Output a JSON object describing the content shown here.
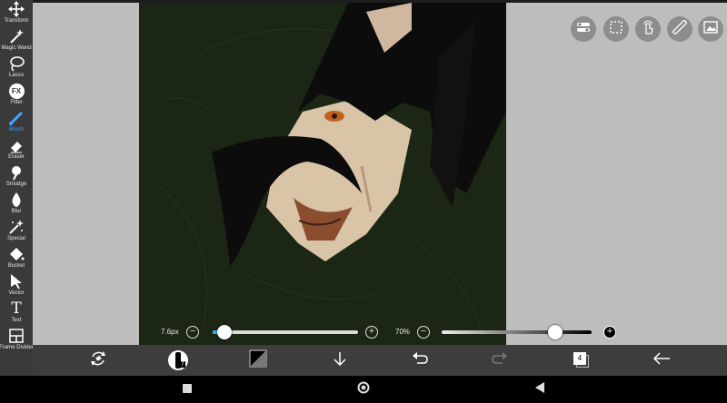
{
  "toolbar": {
    "tools": [
      {
        "label": "Transform",
        "icon": "move-arrows-icon"
      },
      {
        "label": "Magic Wand",
        "icon": "magic-wand-icon"
      },
      {
        "label": "Lasso",
        "icon": "lasso-icon"
      },
      {
        "label": "Filter",
        "icon": "fx-icon"
      },
      {
        "label": "Brush",
        "icon": "brush-icon"
      },
      {
        "label": "Eraser",
        "icon": "eraser-icon"
      },
      {
        "label": "Smudge",
        "icon": "smudge-icon"
      },
      {
        "label": "Blur",
        "icon": "droplet-icon"
      },
      {
        "label": "Special",
        "icon": "sparkle-wand-icon"
      },
      {
        "label": "Bucket",
        "icon": "bucket-icon"
      },
      {
        "label": "Vector",
        "icon": "cursor-arrow-icon"
      },
      {
        "label": "Text",
        "icon": "text-t-icon"
      },
      {
        "label": "Frame Divider",
        "icon": "frame-divider-icon"
      }
    ],
    "fx_text": "FX",
    "text_glyph": "T",
    "active_tool": "Brush"
  },
  "sliders": {
    "size_label": "7.6px",
    "size_minus": "−",
    "size_plus": "+",
    "opacity_label": "70%",
    "opacity_minus": "−",
    "opacity_plus": "+"
  },
  "size_slider": {
    "value_fraction": 0.08
  },
  "opacity_slider": {
    "value_fraction": 0.76
  },
  "bottombar": {
    "layer_count": "4",
    "brush_size_badge": "7"
  },
  "quick_icons": [
    "toggle-icon",
    "selection-icon",
    "touch-icon",
    "ruler-icon",
    "image-icon"
  ],
  "colors": {
    "toolbar_bg": "#3a3a3a",
    "workspace_bg": "#bdbdbd",
    "canvas_bg": "#1b2615",
    "accent": "#3ea6ff",
    "bottombar_bg": "#3d3d3d"
  }
}
